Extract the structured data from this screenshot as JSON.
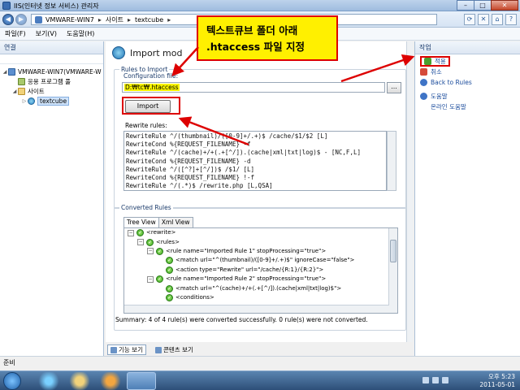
{
  "window": {
    "title": "IIS(인터넷 정보 서비스) 관리자",
    "buttons": {
      "minimize": "–",
      "maximize": "□",
      "close": "✕"
    }
  },
  "address": {
    "back": "◀",
    "forward": "▶",
    "crumbs": [
      "VMWARE-WIN7",
      "사이트",
      "textcube"
    ],
    "separator": "▸"
  },
  "menu": [
    "파일(F)",
    "보기(V)",
    "도움말(H)"
  ],
  "connections": {
    "title": "연결",
    "tree": [
      {
        "label": "VMWARE-WIN7(VMWARE-W",
        "twisty": "◢",
        "icon": "server-icon"
      },
      {
        "label": "응용 프로그램 풀",
        "twisty": "",
        "icon": "app-pool-icon"
      },
      {
        "label": "사이트",
        "twisty": "◢",
        "icon": "folder-icon"
      },
      {
        "label": "textcube",
        "twisty": "▷",
        "icon": "globe-icon"
      }
    ]
  },
  "main": {
    "title": "Import mod",
    "rules_group": "Rules to Import",
    "config_label": "Configuration file:",
    "config_value": "D:₩tc₩.htaccess",
    "browse_label": "...",
    "import_label": "Import",
    "rewrite_label": "Rewrite rules:",
    "rewrite_rules": [
      "RewriteRule ^/(thumbnail)/([0-9]+/.+)$ /cache/$1/$2 [L]",
      "RewriteCond %{REQUEST_FILENAME} -f",
      "RewriteRule ^/(cache)+/+(.+[^/]).(cache|xml|txt|log)$ - [NC,F,L]",
      "RewriteCond %{REQUEST_FILENAME} -d",
      "RewriteRule ^/([^?]+[^/])$ /$1/ [L]",
      "RewriteCond %{REQUEST_FILENAME} !-f",
      "RewriteRule ^/(.*)$ /rewrite.php [L,QSA]"
    ],
    "converted_group": "Converted Rules",
    "tabs": [
      "Tree View",
      "Xml View"
    ],
    "tree_view": [
      {
        "indent": 0,
        "text": "<rewrite>"
      },
      {
        "indent": 1,
        "text": "<rules>"
      },
      {
        "indent": 2,
        "text": "<rule name=\"Imported Rule 1\" stopProcessing=\"true\">"
      },
      {
        "indent": 3,
        "text": "<match url=\"^(thumbnail)/([0-9]+/.+)$\" ignoreCase=\"false\">"
      },
      {
        "indent": 3,
        "text": "<action type=\"Rewrite\" url=\"/cache/{R:1}/{R:2}\">"
      },
      {
        "indent": 2,
        "text": "<rule name=\"Imported Rule 2\" stopProcessing=\"true\">"
      },
      {
        "indent": 3,
        "text": "<match url=\"^(cache)+/+(.+[^/]).(cache|xml|txt|log)$\">"
      },
      {
        "indent": 3,
        "text": "<conditions>"
      }
    ],
    "summary": "Summary: 4 of 4 rule(s) were converted successfully. 0 rule(s) were not converted."
  },
  "view_tabs": [
    "기능 보기",
    "콘텐츠 보기"
  ],
  "actions": {
    "title": "작업",
    "items": [
      "적용",
      "취소",
      "Back to Rules",
      "도움말",
      "온라인 도움말"
    ]
  },
  "status": "준비",
  "taskbar": {
    "time": "오후 5:23",
    "date": "2011-05-01"
  },
  "callout": {
    "line1": "텍스트큐브 폴더 아래",
    "line2": ".htaccess 파일 지정"
  },
  "colors": {
    "annotation_red": "#dd0000",
    "annotation_yellow": "#fff000",
    "link_blue": "#1b4c9c"
  }
}
